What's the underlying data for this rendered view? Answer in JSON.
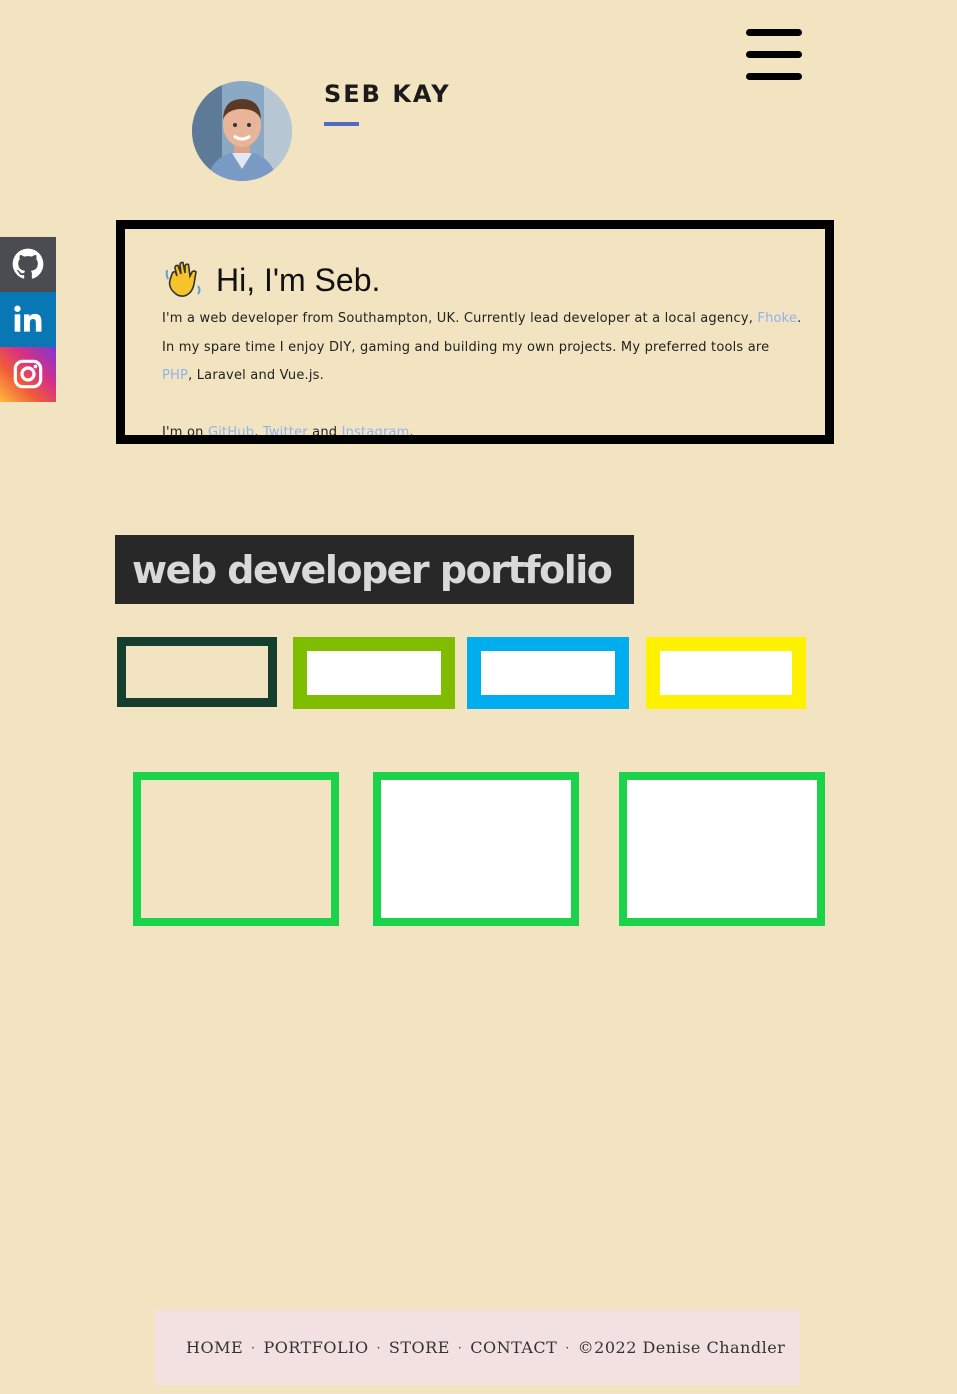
{
  "header": {
    "name": "SEB KAY",
    "menu_icon": "hamburger-menu-icon",
    "avatar_alt": "Seb Kay"
  },
  "social": [
    {
      "name": "GitHub",
      "icon": "github-icon",
      "color": "#4a4c52"
    },
    {
      "name": "LinkedIn",
      "icon": "linkedin-icon",
      "color": "#0a77b5"
    },
    {
      "name": "Instagram",
      "icon": "instagram-icon",
      "color": "#d42f87"
    }
  ],
  "intro": {
    "heading": "Hi, I'm Seb.",
    "wave_icon": "waving-hand-icon",
    "p1_a": "I'm a web developer from Southampton, UK. Currently lead developer at a local agency, ",
    "p1_link": "Fhoke",
    "p1_b": ". In my spare time I enjoy DIY, gaming and building my own projects. My preferred tools are ",
    "p1_link2": "PHP",
    "p1_c": ", Laravel and Vue.js.",
    "p2_a": "I'm on ",
    "p2_github": "GitHub",
    "p2_sep1": ", ",
    "p2_twitter": "Twitter",
    "p2_and": " and ",
    "p2_instagram": "Instagram",
    "p2_end": "."
  },
  "portfolio": {
    "title": "web developer portfolio"
  },
  "colors": {
    "background": "#f2e4c0",
    "filter_colors": [
      "#153e2e",
      "#80bc00",
      "#00adef",
      "#fff200"
    ],
    "card_border": "#1ad34b",
    "footer_bg": "#f3e1e2",
    "accent": "#4f6bbf"
  },
  "footer": {
    "home": "HOME",
    "portfolio": "PORTFOLIO",
    "store": "STORE",
    "contact": "CONTACT",
    "copyright": "©2022 Denise Chandler",
    "separator": "·"
  }
}
